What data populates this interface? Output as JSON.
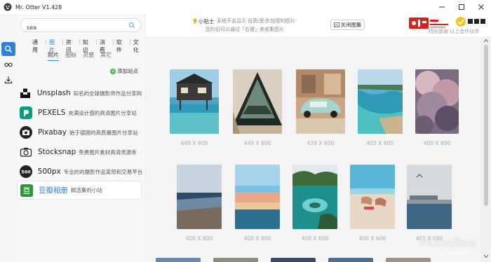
{
  "app": {
    "title": "Mr. Otter V1.428"
  },
  "search": {
    "value": "sea",
    "placeholder": ""
  },
  "categories": [
    "通用",
    "图片",
    "资讯",
    "知识",
    "消费",
    "软件",
    "文化"
  ],
  "active_category": "图片",
  "subcategories": [
    "照片",
    "图标",
    "灵感",
    "其它"
  ],
  "add_site_label": "添加站点",
  "sites": [
    {
      "name": "Unsplash",
      "desc": "知名的全球摄影师作品分享网站"
    },
    {
      "name": "PEXELS",
      "desc": "充满设计感的高清图片分享站"
    },
    {
      "name": "Pixabay",
      "desc": "始于德国的高质量图片分享站"
    },
    {
      "name": "Stocksnap",
      "desc": "免费图片素材高清资源库"
    },
    {
      "name": "500px",
      "desc": "专业的的摄影作品发现和交易平台"
    },
    {
      "name": "豆瓣相册",
      "desc": "精选集的小站"
    }
  ],
  "tip": {
    "title": "小贴士",
    "line1": "系统不会显示 低质/受涉/加密的图片",
    "line2": "您的旧可以通过「右键」来收集图片"
  },
  "close_gallery_label": "关闭图集",
  "brand": {
    "tagline": "特别感谢 以上合作伙伴"
  },
  "images": [
    {
      "dim": "449 X 600",
      "theme": "overwater-villa"
    },
    {
      "dim": "449 X 600",
      "theme": "tent-view"
    },
    {
      "dim": "439 X 600",
      "theme": "vintage-car"
    },
    {
      "dim": "405 X 600",
      "theme": "coastline"
    },
    {
      "dim": "400 X 600",
      "theme": "clouds"
    },
    {
      "dim": "400 X 600",
      "theme": "beach-dusk"
    },
    {
      "dim": "400 X 600",
      "theme": "sunset-sea"
    },
    {
      "dim": "400 X 600",
      "theme": "lagoon-islands"
    },
    {
      "dim": "400 X 600",
      "theme": "sunbathing"
    },
    {
      "dim": "400 X 600",
      "theme": "harbor"
    }
  ],
  "watermark": {
    "text": "PConline",
    "sub": "太平洋电脑网"
  },
  "colors": {
    "accent": "#2c82d8",
    "add_green": "#4caf50"
  }
}
